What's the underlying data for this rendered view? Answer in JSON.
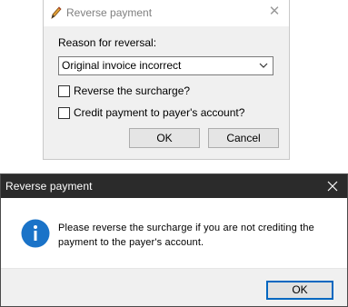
{
  "background_dialog": {
    "title": "Reverse payment",
    "reason_label": "Reason for reversal:",
    "reason_selected": "Original invoice incorrect",
    "checkbox_surcharge": "Reverse the surcharge?",
    "checkbox_credit": "Credit payment to payer's account?",
    "ok_label": "OK",
    "cancel_label": "Cancel"
  },
  "message_box": {
    "title": "Reverse payment",
    "message_line1": "Please reverse the surcharge if you are not crediting the",
    "message_line2": "payment to the payer's account.",
    "ok_label": "OK"
  },
  "icons": {
    "app": "pencil-icon",
    "info": "info-icon",
    "close": "close-icon",
    "dropdown": "chevron-down-icon"
  },
  "colors": {
    "titlebar_active": "#2b2b2b",
    "info_blue": "#1a73c8",
    "focus_border": "#0067c0"
  }
}
